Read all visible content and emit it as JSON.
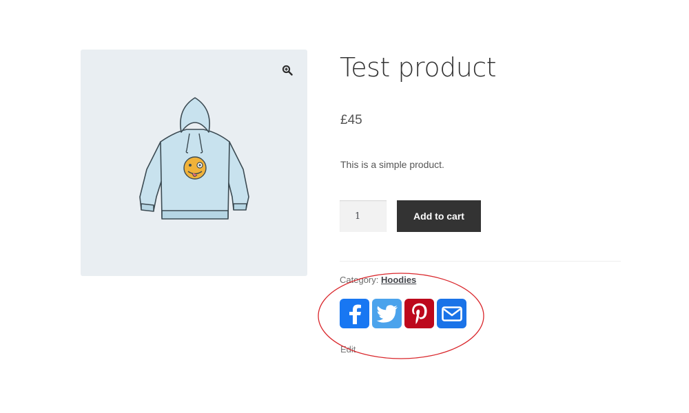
{
  "gallery": {
    "zoom_icon": "zoom-in-icon",
    "image_icon": "hoodie-illustration"
  },
  "product": {
    "title": "Test product",
    "price": "£45",
    "description": "This is a simple product.",
    "quantity": "1",
    "add_to_cart_label": "Add to cart",
    "category_label": "Category:",
    "category_value": "Hoodies",
    "edit_label": "Edit"
  },
  "share_buttons": [
    {
      "icon": "facebook-icon",
      "color": "#1877f2"
    },
    {
      "icon": "twitter-icon",
      "color": "#4ba3ec"
    },
    {
      "icon": "pinterest-icon",
      "color": "#bd081c"
    },
    {
      "icon": "email-icon",
      "color": "#1a73e8"
    }
  ],
  "annotation": {
    "color": "#d9252a"
  }
}
